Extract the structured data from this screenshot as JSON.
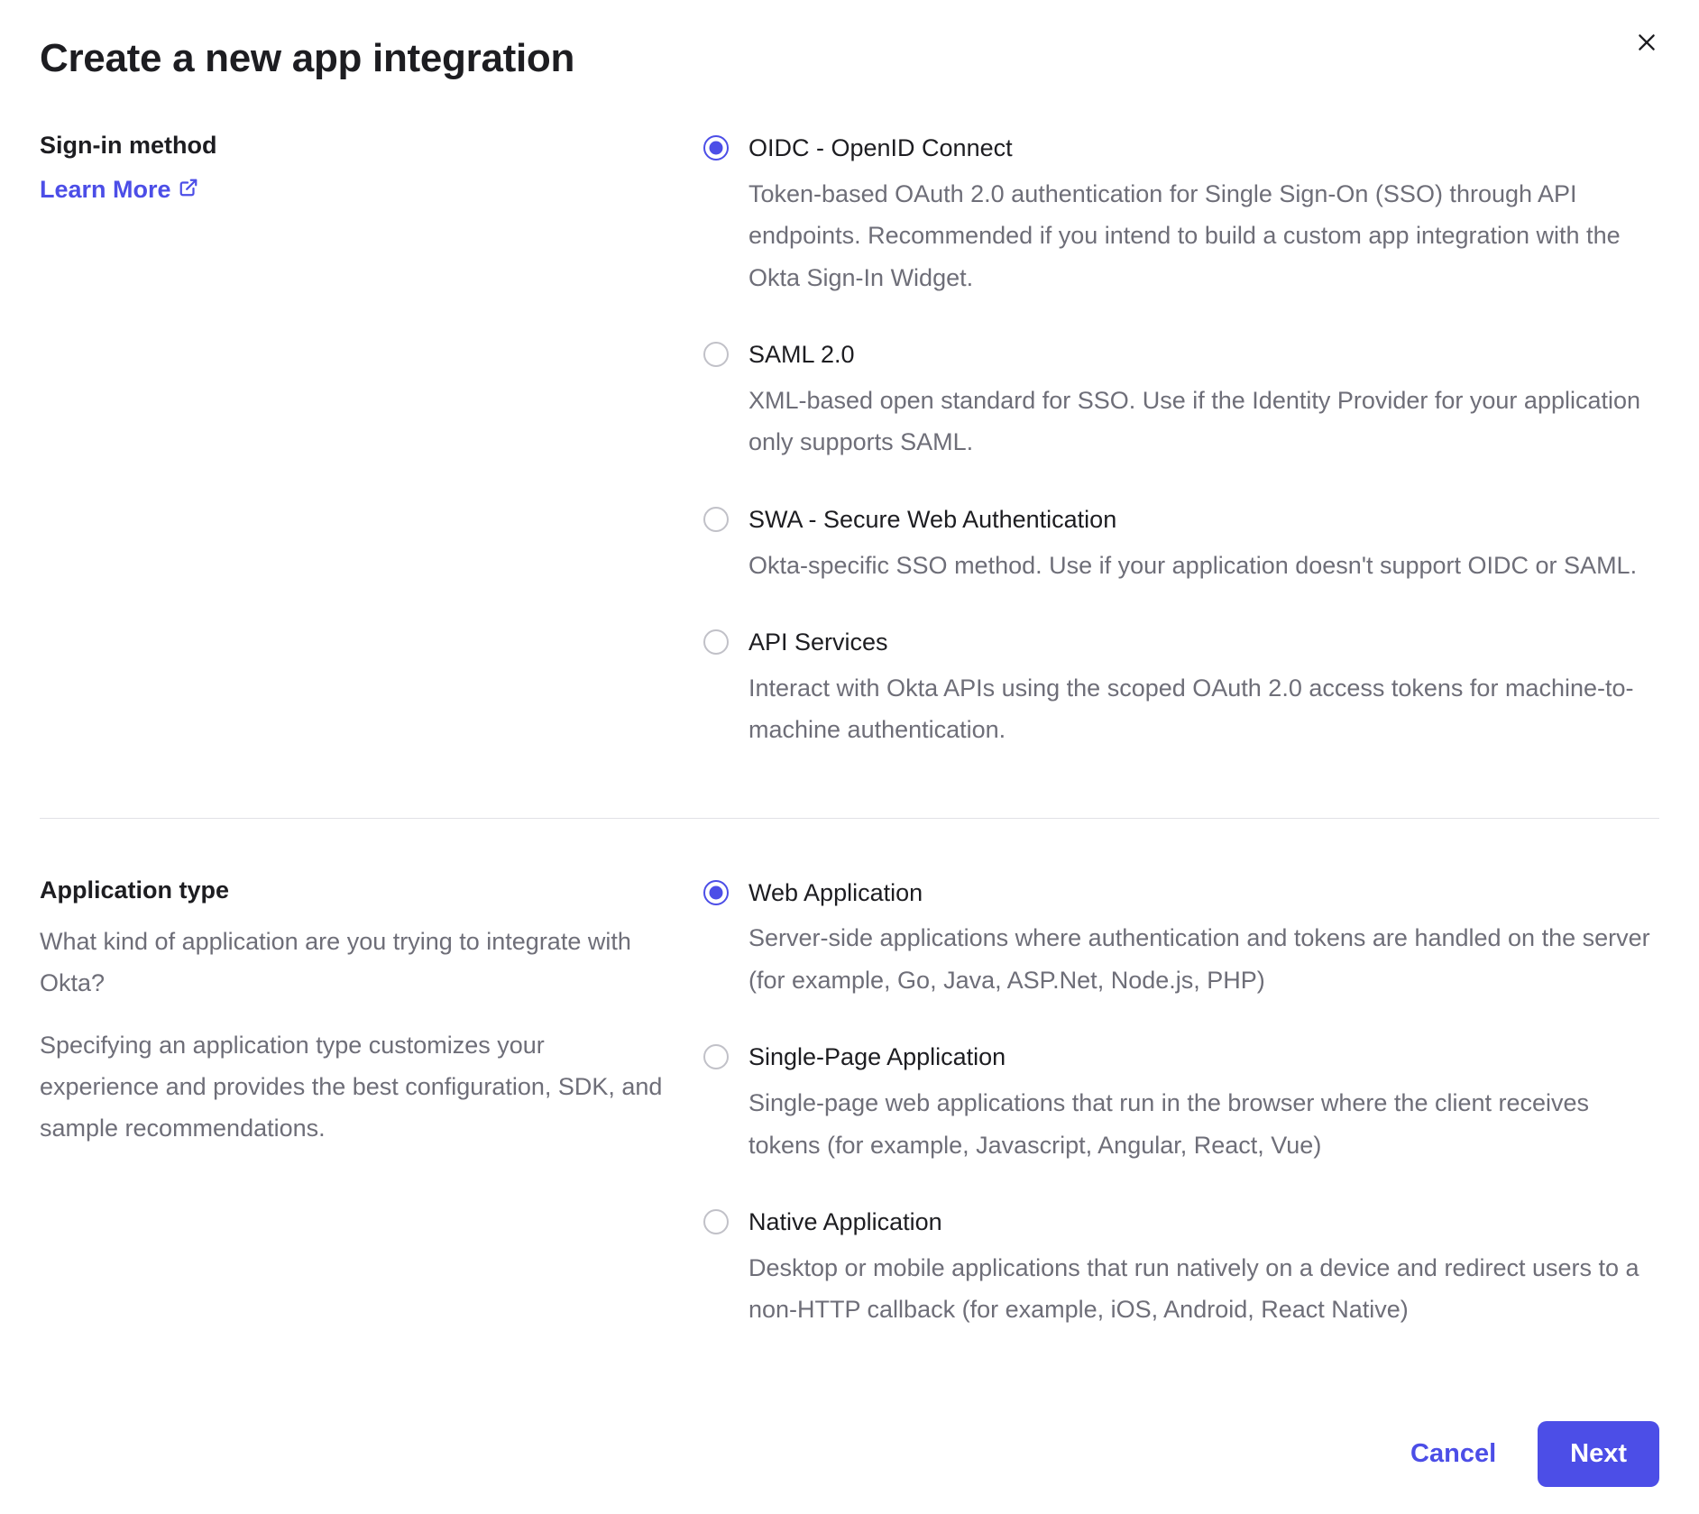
{
  "dialog": {
    "title": "Create a new app integration"
  },
  "signin": {
    "label": "Sign-in method",
    "learn_more": "Learn More",
    "options": [
      {
        "title": "OIDC - OpenID Connect",
        "desc": "Token-based OAuth 2.0 authentication for Single Sign-On (SSO) through API endpoints. Recommended if you intend to build a custom app integration with the Okta Sign-In Widget.",
        "selected": true
      },
      {
        "title": "SAML 2.0",
        "desc": "XML-based open standard for SSO. Use if the Identity Provider for your application only supports SAML.",
        "selected": false
      },
      {
        "title": "SWA - Secure Web Authentication",
        "desc": "Okta-specific SSO method. Use if your application doesn't support OIDC or SAML.",
        "selected": false
      },
      {
        "title": "API Services",
        "desc": "Interact with Okta APIs using the scoped OAuth 2.0 access tokens for machine-to-machine authentication.",
        "selected": false
      }
    ]
  },
  "apptype": {
    "label": "Application type",
    "desc1": "What kind of application are you trying to integrate with Okta?",
    "desc2": "Specifying an application type customizes your experience and provides the best configuration, SDK, and sample recommendations.",
    "options": [
      {
        "title": "Web Application",
        "desc": "Server-side applications where authentication and tokens are handled on the server (for example, Go, Java, ASP.Net, Node.js, PHP)",
        "selected": true
      },
      {
        "title": "Single-Page Application",
        "desc": "Single-page web applications that run in the browser where the client receives tokens (for example, Javascript, Angular, React, Vue)",
        "selected": false
      },
      {
        "title": "Native Application",
        "desc": "Desktop or mobile applications that run natively on a device and redirect users to a non-HTTP callback (for example, iOS, Android, React Native)",
        "selected": false
      }
    ]
  },
  "footer": {
    "cancel": "Cancel",
    "next": "Next"
  }
}
